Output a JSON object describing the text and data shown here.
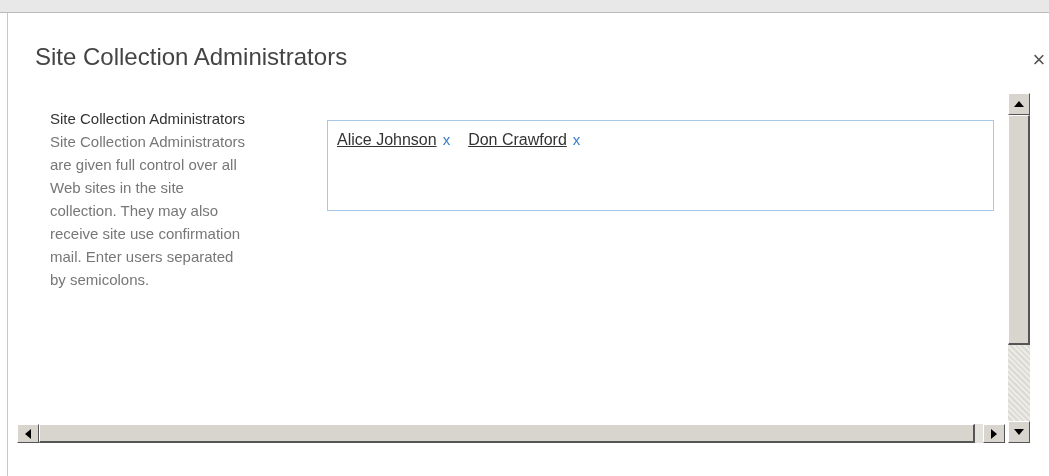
{
  "dialog": {
    "title": "Site Collection Administrators",
    "close": "×"
  },
  "section": {
    "heading": "Site Collection Administrators",
    "description": "Site Collection Administrators are given full control over all Web sites in the site collection. They may also receive site use confirmation mail. Enter users separated by semicolons."
  },
  "people_picker": {
    "people": [
      {
        "name": "Alice Johnson",
        "remove": "x"
      },
      {
        "name": "Don Crawford",
        "remove": "x"
      }
    ]
  }
}
